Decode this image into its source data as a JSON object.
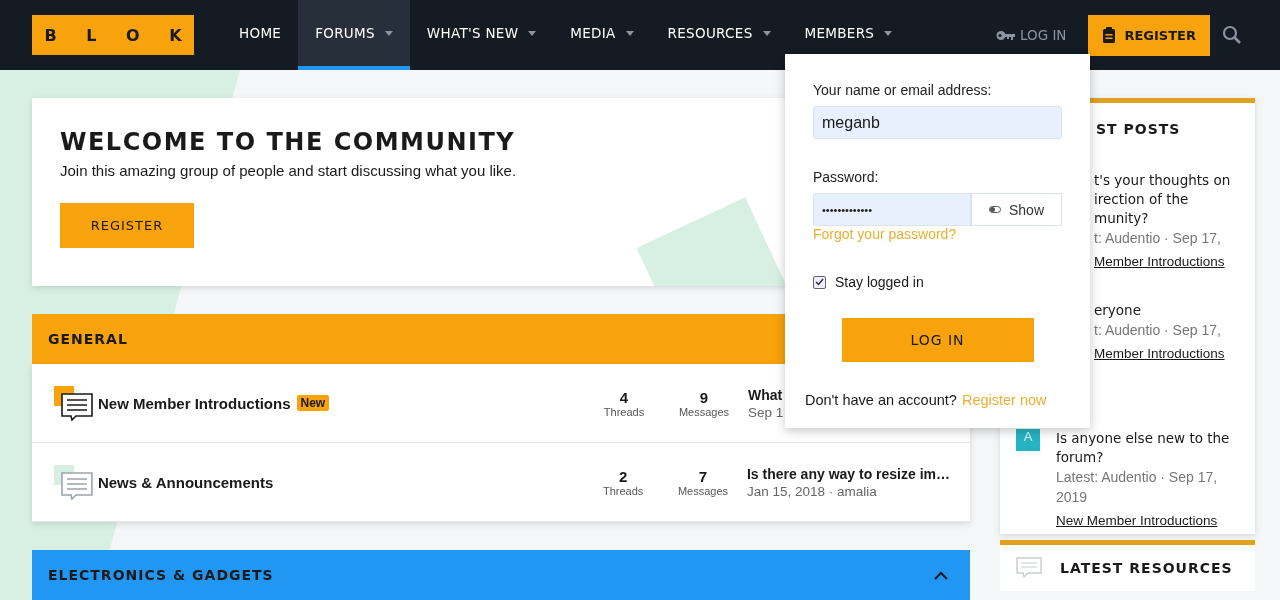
{
  "logo": "B L O K",
  "nav": [
    {
      "label": "HOME",
      "selected": false,
      "dropdown": false
    },
    {
      "label": "FORUMS",
      "selected": true,
      "dropdown": true
    },
    {
      "label": "WHAT'S NEW",
      "selected": false,
      "dropdown": true
    },
    {
      "label": "MEDIA",
      "selected": false,
      "dropdown": true
    },
    {
      "label": "RESOURCES",
      "selected": false,
      "dropdown": true
    },
    {
      "label": "MEMBERS",
      "selected": false,
      "dropdown": true
    }
  ],
  "login_link": "LOG IN",
  "register_button": "REGISTER",
  "welcome": {
    "title": "WELCOME TO THE COMMUNITY",
    "text": "Join this amazing group of people and start discussing what you like.",
    "button": "REGISTER"
  },
  "categories": [
    {
      "title": "GENERAL",
      "color": "#f8a20c",
      "forums": [
        {
          "name": "New Member Introductions",
          "badge": "New",
          "unread": true,
          "threads": "4",
          "threads_label": "Threads",
          "messages": "9",
          "messages_label": "Messages",
          "last_title": "What",
          "last_meta": "Sep 1"
        },
        {
          "name": "News & Announcements",
          "unread": false,
          "threads": "2",
          "threads_label": "Threads",
          "messages": "7",
          "messages_label": "Messages",
          "last_title": "Is there any way to resize im…",
          "last_meta": "Jan 15, 2018 · amalia"
        }
      ]
    },
    {
      "title": "ELECTRONICS & GADGETS",
      "color": "#2196f3",
      "collapse_icon": true
    }
  ],
  "sidebar": {
    "title": "ST POSTS",
    "posts": [
      {
        "title_lines": [
          "t's your thoughts on",
          "irection of the",
          "munity?"
        ],
        "meta_lines": [
          "t: Audentio · Sep 17,"
        ],
        "forum": "Member Introductions"
      },
      {
        "title_lines": [
          "eryone"
        ],
        "meta_lines": [
          "t: Audentio · Sep 17,"
        ],
        "forum": "Member Introductions"
      },
      {
        "avatar": "A",
        "title_lines": [
          "Is anyone else new to the",
          "forum?"
        ],
        "meta_lines": [
          "Latest: Audentio · Sep 17,",
          "2019"
        ],
        "forum": "New Member Introductions"
      }
    ],
    "next_title": "LATEST RESOURCES"
  },
  "login_popup": {
    "name_label": "Your name or email address:",
    "name_value": "meganb",
    "password_label": "Password:",
    "password_value": "•••••••••••••",
    "show_button": "Show",
    "forgot_link": "Forgot your password?",
    "stay_logged_in": {
      "label": "Stay logged in",
      "checked": true
    },
    "submit": "LOG IN",
    "no_account_text": "Don't have an account?",
    "register_link": "Register now"
  }
}
